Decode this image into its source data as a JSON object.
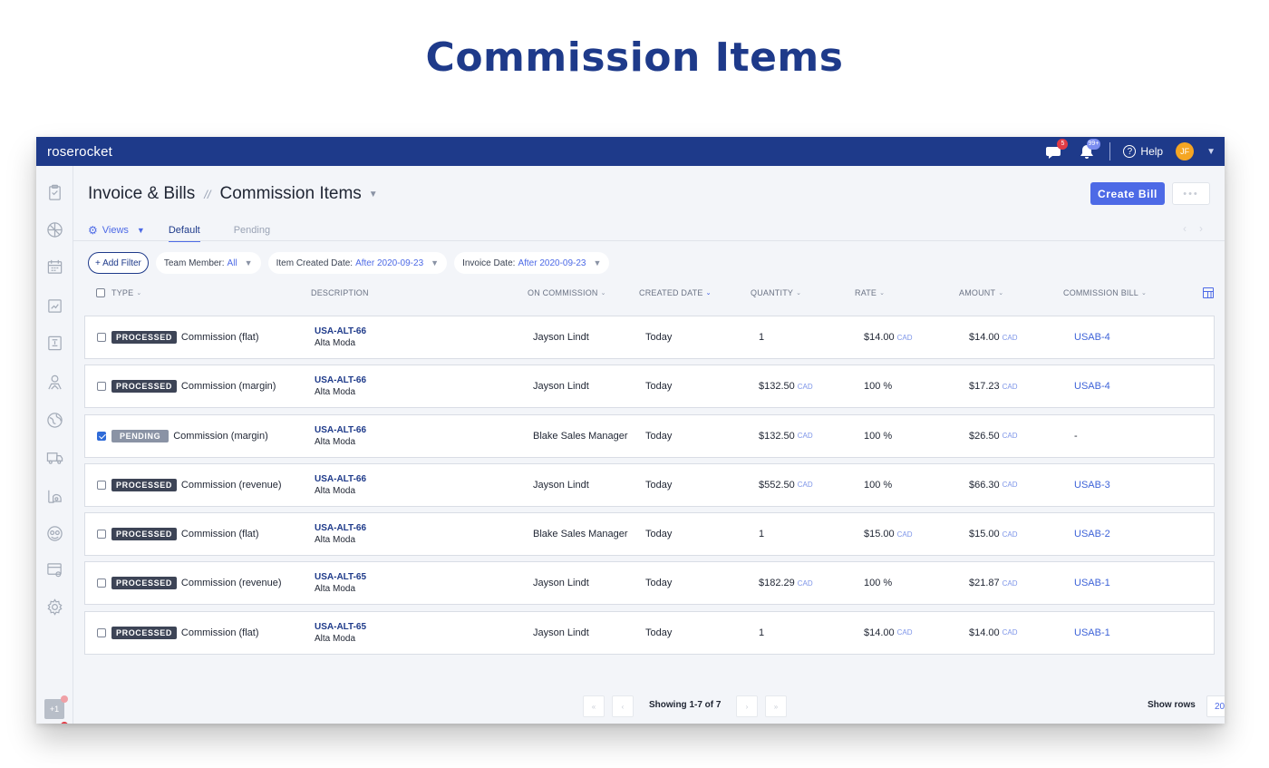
{
  "page": {
    "heading": "Commission Items"
  },
  "topbar": {
    "logo": "roserocket",
    "messages_badge": "5",
    "notifications_badge": "99+",
    "help_label": "Help",
    "avatar_initials": "JF"
  },
  "header": {
    "breadcrumb_root": "Invoice & Bills",
    "breadcrumb_sep": "//",
    "breadcrumb_current": "Commission Items",
    "create_bill_label": "Create Bill"
  },
  "views": {
    "label": "Views",
    "tabs": [
      {
        "label": "Default"
      },
      {
        "label": "Pending"
      }
    ]
  },
  "filters": {
    "add_label": "+ Add Filter",
    "items": [
      {
        "label": "Team Member:",
        "value": "All"
      },
      {
        "label": "Item Created Date:",
        "value": "After 2020-09-23"
      },
      {
        "label": "Invoice Date:",
        "value": "After 2020-09-23"
      }
    ]
  },
  "table": {
    "columns": {
      "type": "TYPE",
      "description": "DESCRIPTION",
      "on_commission": "ON COMMISSION",
      "created_date": "CREATED DATE",
      "quantity": "QUANTITY",
      "rate": "RATE",
      "amount": "AMOUNT",
      "commission_bill": "COMMISSION BILL"
    },
    "currency": "CAD",
    "rows": [
      {
        "checked": false,
        "status": "PROCESSED",
        "type": "Commission (flat)",
        "code": "USA-ALT-66",
        "client": "Alta Moda",
        "on_commission": "Jayson Lindt",
        "created": "Today",
        "quantity": "1",
        "quantity_cad": false,
        "rate": "$14.00",
        "rate_cad": true,
        "amount": "$14.00",
        "bill": "USAB-4"
      },
      {
        "checked": false,
        "status": "PROCESSED",
        "type": "Commission (margin)",
        "code": "USA-ALT-66",
        "client": "Alta Moda",
        "on_commission": "Jayson Lindt",
        "created": "Today",
        "quantity": "$132.50",
        "quantity_cad": true,
        "rate": "100 %",
        "rate_cad": false,
        "amount": "$17.23",
        "bill": "USAB-4"
      },
      {
        "checked": true,
        "status": "PENDING",
        "type": "Commission (margin)",
        "code": "USA-ALT-66",
        "client": "Alta Moda",
        "on_commission": "Blake Sales Manager",
        "created": "Today",
        "quantity": "$132.50",
        "quantity_cad": true,
        "rate": "100 %",
        "rate_cad": false,
        "amount": "$26.50",
        "bill": "-"
      },
      {
        "checked": false,
        "status": "PROCESSED",
        "type": "Commission (revenue)",
        "code": "USA-ALT-66",
        "client": "Alta Moda",
        "on_commission": "Jayson Lindt",
        "created": "Today",
        "quantity": "$552.50",
        "quantity_cad": true,
        "rate": "100 %",
        "rate_cad": false,
        "amount": "$66.30",
        "bill": "USAB-3"
      },
      {
        "checked": false,
        "status": "PROCESSED",
        "type": "Commission (flat)",
        "code": "USA-ALT-66",
        "client": "Alta Moda",
        "on_commission": "Blake Sales Manager",
        "created": "Today",
        "quantity": "1",
        "quantity_cad": false,
        "rate": "$15.00",
        "rate_cad": true,
        "amount": "$15.00",
        "bill": "USAB-2"
      },
      {
        "checked": false,
        "status": "PROCESSED",
        "type": "Commission (revenue)",
        "code": "USA-ALT-65",
        "client": "Alta Moda",
        "on_commission": "Jayson Lindt",
        "created": "Today",
        "quantity": "$182.29",
        "quantity_cad": true,
        "rate": "100 %",
        "rate_cad": false,
        "amount": "$21.87",
        "bill": "USAB-1"
      },
      {
        "checked": false,
        "status": "PROCESSED",
        "type": "Commission (flat)",
        "code": "USA-ALT-65",
        "client": "Alta Moda",
        "on_commission": "Jayson Lindt",
        "created": "Today",
        "quantity": "1",
        "quantity_cad": false,
        "rate": "$14.00",
        "rate_cad": true,
        "amount": "$14.00",
        "bill": "USAB-1"
      }
    ]
  },
  "footer": {
    "showing": "Showing 1-7 of 7",
    "show_rows_label": "Show rows",
    "rows_per_page": "20"
  },
  "colors": {
    "brand": "#1e3a8a",
    "accent": "#4d6ae6",
    "badge_red": "#e23b45"
  }
}
